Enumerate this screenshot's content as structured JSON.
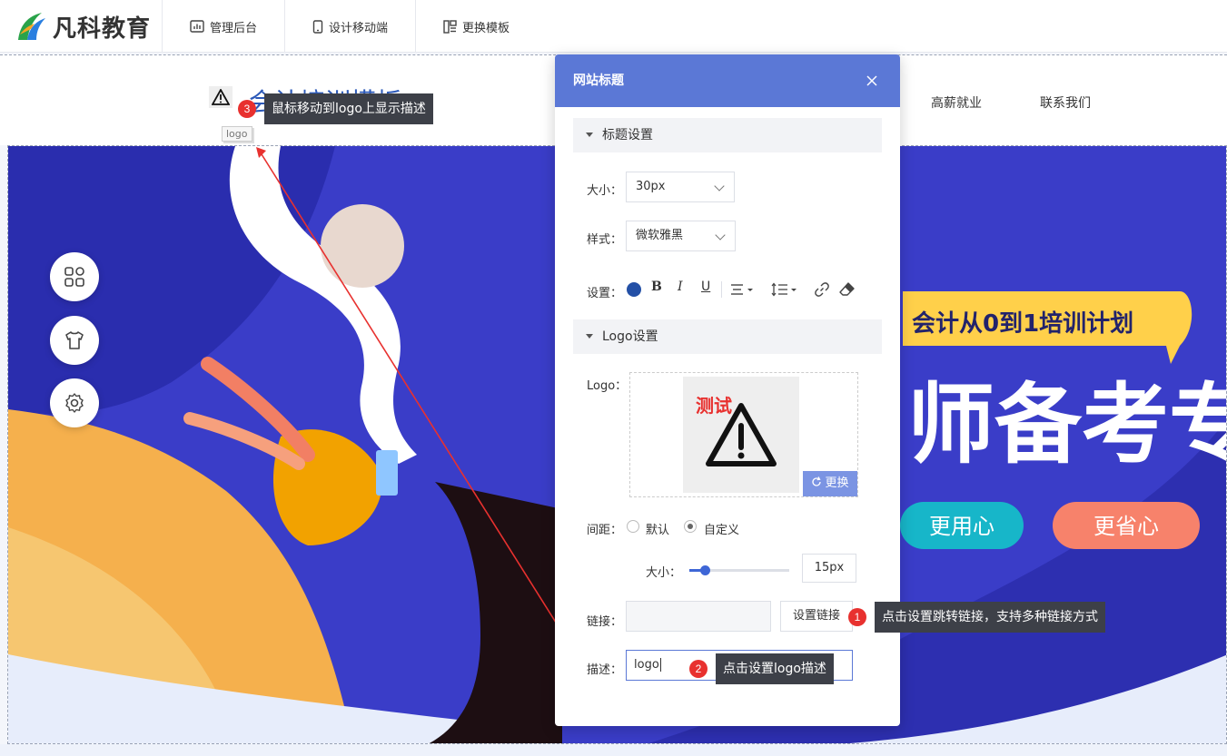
{
  "app": {
    "brand_name": "凡科教育",
    "nav": [
      {
        "label": "管理后台",
        "icon": "chart-icon"
      },
      {
        "label": "设计移动端",
        "icon": "mobile-icon"
      },
      {
        "label": "更换模板",
        "icon": "template-icon"
      }
    ]
  },
  "site": {
    "title": "会计培训模板",
    "nav": [
      "高薪就业",
      "联系我们"
    ],
    "logo_hover_label": "logo"
  },
  "banner": {
    "headline": "会计从0到1培训计划",
    "big_text": "师备考专",
    "pill_1": "更用心",
    "pill_2": "更省心"
  },
  "panel": {
    "title": "网站标题",
    "title_section": {
      "header": "标题设置",
      "size_label": "大小：",
      "size_value": "30px",
      "style_label": "样式：",
      "style_value": "微软雅黑",
      "settings_label": "设置：",
      "text_color": "#2350a6"
    },
    "logo_section": {
      "header": "Logo设置",
      "logo_label": "Logo：",
      "preview_text": "测试",
      "change_button": "更换",
      "spacing_label": "间距：",
      "option_default": "默认",
      "option_custom": "自定义",
      "selected": "自定义",
      "size_label": "大小：",
      "size_value": "15px",
      "size_fraction": 0.15,
      "link_label": "链接：",
      "link_value": "",
      "set_link_button": "设置链接",
      "desc_label": "描述：",
      "desc_value": "logo"
    }
  },
  "annotations": [
    {
      "number": "1",
      "text": "点击设置跳转链接，支持多种链接方式"
    },
    {
      "number": "2",
      "text": "点击设置logo描述"
    },
    {
      "number": "3",
      "text": "鼠标移动到logo上显示描述"
    }
  ],
  "colors": {
    "accent": "#5b78d6",
    "badge": "#e8312f",
    "tooltip_bg": "#3d4048",
    "banner_blue": "#3a3dc8"
  }
}
